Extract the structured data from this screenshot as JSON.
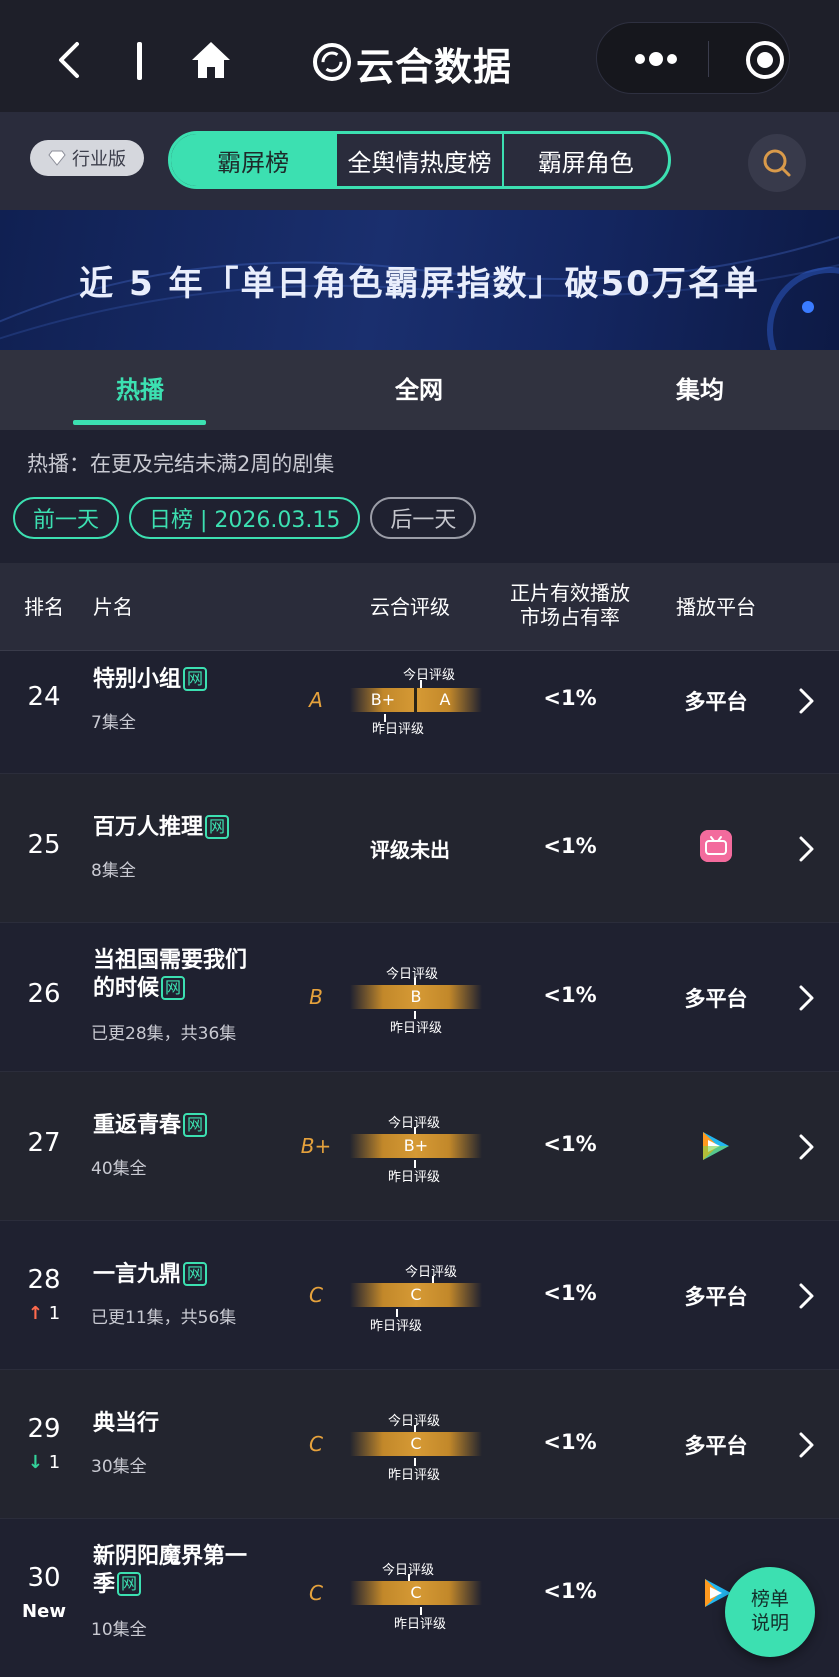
{
  "topbar": {
    "app_title": "云合数据"
  },
  "tabsbar": {
    "edition": "行业版",
    "segments": [
      "霸屏榜",
      "全舆情热度榜",
      "霸屏角色"
    ],
    "active_segment": 0
  },
  "banner": {
    "title": "近 5 年「单日角色霸屏指数」破50万名单"
  },
  "subtabs": {
    "items": [
      "热播",
      "全网",
      "集均"
    ],
    "active": 0
  },
  "description": "热播：在更及完结未满2周的剧集",
  "date_nav": {
    "prev": "前一天",
    "current": "日榜 | 2026.03.15",
    "next": "后一天"
  },
  "table": {
    "headers": {
      "rank": "排名",
      "name": "片名",
      "grade": "云合评级",
      "share_line1": "正片有效播放",
      "share_line2": "市场占有率",
      "platform": "播放平台"
    },
    "grade_labels": {
      "today": "今日评级",
      "yesterday": "昨日评级"
    },
    "net_tag": "网",
    "rows": [
      {
        "rank": "24",
        "name": "特别小组",
        "eps": "7集全",
        "grade": "A",
        "yesterday_grade": "B+",
        "today_grade": "A",
        "share": "<1%",
        "platform": "多平台"
      },
      {
        "rank": "25",
        "name": "百万人推理",
        "eps": "8集全",
        "no_grade": "评级未出",
        "share": "<1%",
        "platform_icon": "bilibili-icon"
      },
      {
        "rank": "26",
        "name_line1": "当祖国需要我们",
        "name_line2": "的时候",
        "eps": "已更28集，共36集",
        "grade": "B",
        "bar_grade": "B",
        "share": "<1%",
        "platform": "多平台"
      },
      {
        "rank": "27",
        "name": "重返青春",
        "eps": "40集全",
        "grade": "B+",
        "bar_grade": "B+",
        "share": "<1%",
        "platform_icon": "tencent-video-icon"
      },
      {
        "rank": "28",
        "change": "1",
        "change_dir": "up",
        "name": "一言九鼎",
        "eps": "已更11集，共56集",
        "grade": "C",
        "bar_grade": "C",
        "share": "<1%",
        "platform": "多平台"
      },
      {
        "rank": "29",
        "change": "1",
        "change_dir": "down",
        "name": "典当行",
        "eps": "30集全",
        "grade": "C",
        "bar_grade": "C",
        "share": "<1%",
        "platform": "多平台"
      },
      {
        "rank": "30",
        "tag": "New",
        "name_line1": "新阴阳魔界第一",
        "name_line2": "季",
        "eps": "10集全",
        "grade": "C",
        "bar_grade": "C",
        "share": "<1%",
        "platform_icon": "tencent-video-icon"
      }
    ]
  },
  "explain_button": {
    "line1": "榜单",
    "line2": "说明"
  },
  "colors": {
    "accent": "#3ce0b1",
    "grade": "#e6a23c",
    "up": "#ff6a4d",
    "down": "#34d39b"
  }
}
